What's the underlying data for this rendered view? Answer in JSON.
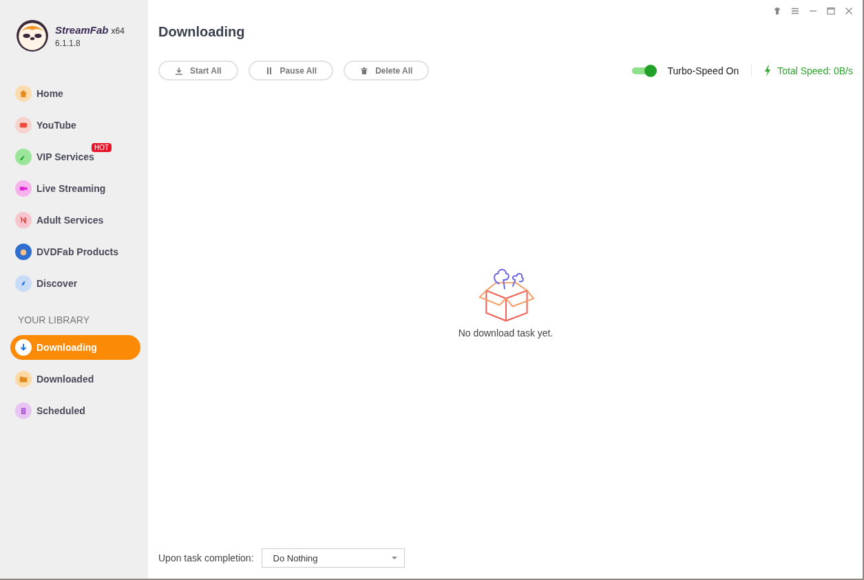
{
  "app": {
    "name": "StreamFab",
    "arch": "x64",
    "version": "6.1.1.8"
  },
  "nav": [
    {
      "kind": "home",
      "label": "Home",
      "selected": false
    },
    {
      "kind": "youtube",
      "label": "YouTube",
      "selected": false
    },
    {
      "kind": "vip",
      "label": "VIP Services",
      "selected": false,
      "badge": "HOT"
    },
    {
      "kind": "live",
      "label": "Live Streaming",
      "selected": false
    },
    {
      "kind": "adult",
      "label": "Adult Services",
      "selected": false
    },
    {
      "kind": "dvdfab",
      "label": "DVDFab Products",
      "selected": false
    },
    {
      "kind": "discover",
      "label": "Discover",
      "selected": false
    }
  ],
  "library": {
    "heading": "YOUR LIBRARY",
    "items": [
      {
        "kind": "downloading",
        "label": "Downloading",
        "selected": true
      },
      {
        "kind": "downloaded",
        "label": "Downloaded",
        "selected": false
      },
      {
        "kind": "scheduled",
        "label": "Scheduled",
        "selected": false
      }
    ]
  },
  "page": {
    "title": "Downloading"
  },
  "toolbar": [
    {
      "kind": "start",
      "label": "Start All"
    },
    {
      "kind": "pause",
      "label": "Pause All"
    },
    {
      "kind": "delete",
      "label": "Delete All"
    }
  ],
  "turbo": {
    "label": "Turbo-Speed On",
    "on": true
  },
  "total_speed": "Total Speed: 0B/s",
  "empty_message": "No download task yet.",
  "completion": {
    "label": "Upon task completion:",
    "value": "Do Nothing"
  }
}
